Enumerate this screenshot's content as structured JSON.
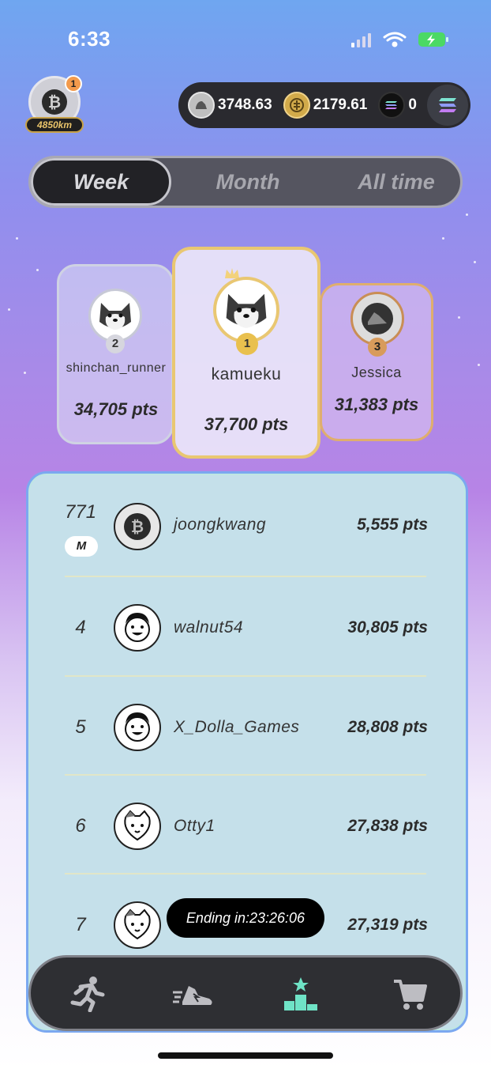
{
  "status_bar": {
    "time": "6:33"
  },
  "header": {
    "avatar_icon": "bitcoin-icon",
    "notification_count": "1",
    "distance": "4850km",
    "balances": [
      {
        "icon": "gst-coin-icon",
        "value": "3748.63"
      },
      {
        "icon": "gmt-coin-icon",
        "value": "2179.61"
      },
      {
        "icon": "sol-coin-icon",
        "value": "0"
      }
    ],
    "chain_button_icon": "solana-icon"
  },
  "period_tabs": {
    "week": "Week",
    "month": "Month",
    "all_time": "All time",
    "selected": "Week"
  },
  "podium": {
    "first": {
      "rank": "1",
      "name": "kamueku",
      "points": "37,700 pts",
      "avatar": "shiba-dog-avatar"
    },
    "second": {
      "rank": "2",
      "name": "shinchan_runner",
      "points": "34,705 pts",
      "avatar": "shiba-dog-avatar"
    },
    "third": {
      "rank": "3",
      "name": "Jessica",
      "points": "31,383 pts",
      "avatar": "sneaker-avatar"
    }
  },
  "leaderboard": {
    "me": {
      "rank": "771",
      "badge": "M",
      "name": "joongkwang",
      "points": "5,555 pts",
      "avatar": "bitcoin-avatar"
    },
    "rows": [
      {
        "rank": "4",
        "name": "walnut54",
        "points": "30,805 pts",
        "avatar": "smiling-face-avatar"
      },
      {
        "rank": "5",
        "name": "X_Dolla_Games",
        "points": "28,808 pts",
        "avatar": "smiling-face-avatar"
      },
      {
        "rank": "6",
        "name": "Otty1",
        "points": "27,838 pts",
        "avatar": "cat-avatar"
      },
      {
        "rank": "7",
        "name": "",
        "points": "27,319 pts",
        "avatar": "cat-avatar"
      }
    ],
    "ending_text": "Ending in:23:26:06"
  },
  "bottom_nav": [
    "run-icon",
    "sneaker-icon",
    "leaderboard-podium-icon",
    "shopping-cart-icon"
  ],
  "colors": {
    "accent_gold": "#e9c772",
    "panel": "#c5e0ea",
    "nav_active": "#6fe3c6"
  }
}
